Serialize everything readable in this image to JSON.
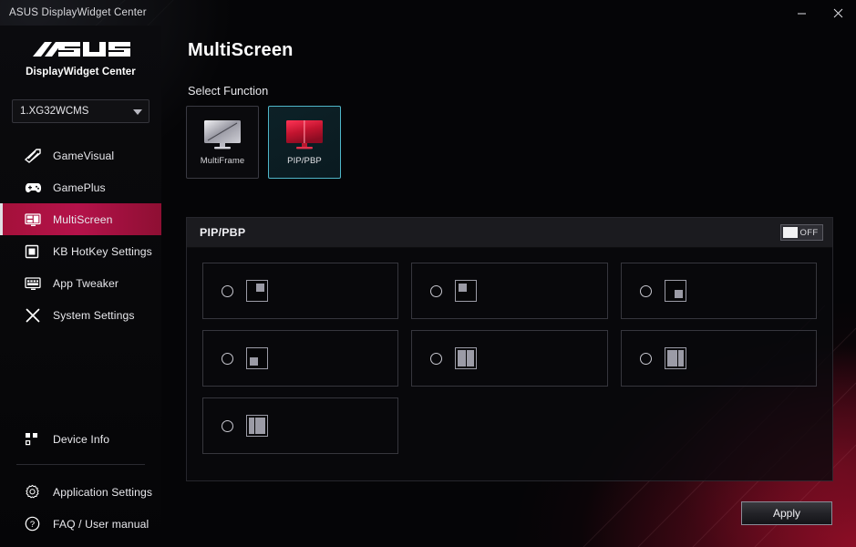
{
  "window": {
    "title": "ASUS DisplayWidget Center",
    "minimize_label": "minimize",
    "close_label": "close"
  },
  "sidebar": {
    "brand_logo": "asus-logo",
    "brand_sub": "DisplayWidget Center",
    "device_select": {
      "value": "1.XG32WCMS",
      "icon": "chevron-down-icon"
    },
    "items": [
      {
        "label": "GameVisual",
        "icon": "gamevisual-icon",
        "active": false
      },
      {
        "label": "GamePlus",
        "icon": "gamepad-icon",
        "active": false
      },
      {
        "label": "MultiScreen",
        "icon": "multiscreen-icon",
        "active": true
      },
      {
        "label": "KB HotKey Settings",
        "icon": "keyboard-icon",
        "active": false
      },
      {
        "label": "App Tweaker",
        "icon": "app-tweaker-icon",
        "active": false
      },
      {
        "label": "System Settings",
        "icon": "tools-icon",
        "active": false
      }
    ],
    "bottom_items": [
      {
        "label": "Device Info",
        "icon": "device-info-icon"
      },
      {
        "label": "Application Settings",
        "icon": "gear-icon"
      },
      {
        "label": "FAQ / User manual",
        "icon": "question-icon"
      }
    ]
  },
  "main": {
    "page_title": "MultiScreen",
    "section_label": "Select Function",
    "function_cards": [
      {
        "label": "MultiFrame",
        "icon": "monitor-multiframe-icon",
        "selected": false
      },
      {
        "label": "PIP/PBP",
        "icon": "monitor-pip-icon",
        "selected": true
      }
    ],
    "panel": {
      "title": "PIP/PBP",
      "toggle": {
        "label": "OFF",
        "state": "off"
      },
      "layouts": [
        {
          "name": "pip-top-right",
          "mode": "pip",
          "pos": "top-right",
          "checked": false
        },
        {
          "name": "pip-top-left",
          "mode": "pip",
          "pos": "top-left",
          "checked": false
        },
        {
          "name": "pip-bottom-right",
          "mode": "pip",
          "pos": "bottom-right",
          "checked": false
        },
        {
          "name": "pip-bottom-left",
          "mode": "pip",
          "pos": "bottom-left",
          "checked": false
        },
        {
          "name": "pbp-equal",
          "mode": "pbp",
          "pos": "equal",
          "checked": false
        },
        {
          "name": "pbp-wide-left",
          "mode": "pbp",
          "pos": "wide-left",
          "checked": false
        },
        {
          "name": "pbp-wide-right",
          "mode": "pbp",
          "pos": "wide-right",
          "checked": false
        }
      ]
    },
    "apply_label": "Apply"
  },
  "colors": {
    "accent_crimson": "#b4124a",
    "accent_cyan": "#4fb6c8",
    "panel_header": "#1b1b1f",
    "background": "#050507"
  }
}
